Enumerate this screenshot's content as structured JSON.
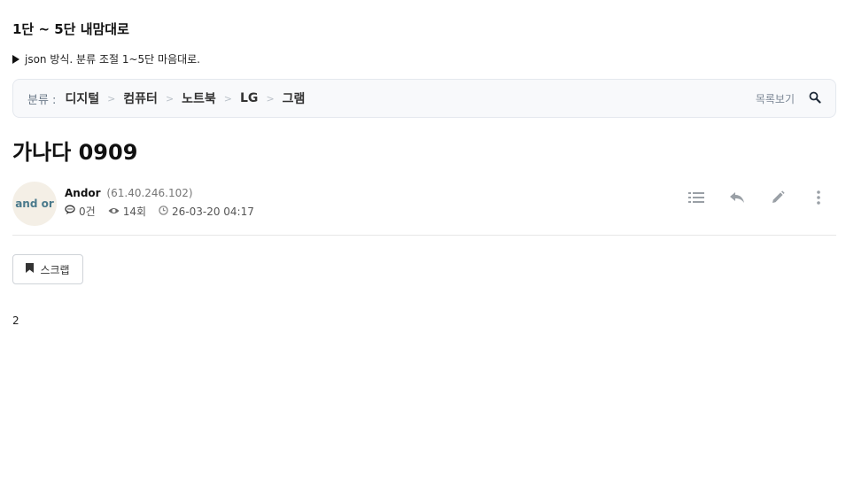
{
  "page": {
    "heading": "1단 ~ 5단 내맘대로",
    "description": "json 방식. 분류 조절 1~5단 마음대로."
  },
  "breadcrumb": {
    "label": "분류 :",
    "items": [
      "디지털",
      "컴퓨터",
      "노트북",
      "LG",
      "그램"
    ],
    "separator": ">",
    "list_link": "목록보기"
  },
  "post": {
    "title": "가나다 0909",
    "author": "Andor",
    "ip": "(61.40.246.102)",
    "avatar_text": "and or",
    "comments": "0건",
    "views": "14회",
    "date": "26-03-20 04:17",
    "body": "2"
  },
  "actions": {
    "list": "list-icon",
    "reply": "reply-icon",
    "edit": "edit-icon",
    "more": "more-vertical-icon"
  },
  "scrap": {
    "label": "스크랩"
  }
}
